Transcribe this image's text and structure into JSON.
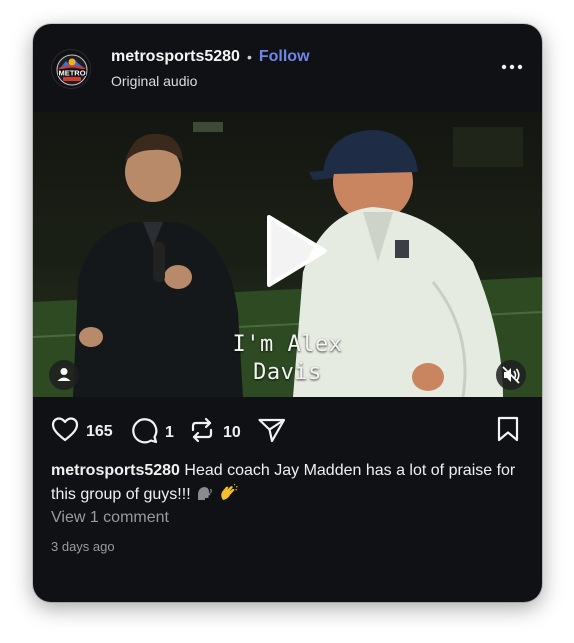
{
  "post": {
    "username": "metrosports5280",
    "separator": "•",
    "follow_label": "Follow",
    "audio_label": "Original audio",
    "avatar_logo_text": "METRO",
    "video": {
      "caption_line1": "I'm Alex",
      "caption_line2": "Davis"
    },
    "actions": {
      "likes": "165",
      "comments": "1",
      "reposts": "10"
    },
    "description": {
      "username": "metrosports5280",
      "text": " Head coach Jay Madden has a lot of praise for this group of guys!!! "
    },
    "view_comments_label": "View 1 comment",
    "timestamp": "3 days ago"
  },
  "icons": {
    "more": "more-horizontal-icon",
    "play": "play-icon",
    "user_tag": "person-icon",
    "mute": "speaker-muted-icon",
    "like": "heart-icon",
    "comment": "comment-bubble-icon",
    "repost": "repost-icon",
    "share": "send-icon",
    "save": "bookmark-icon"
  },
  "colors": {
    "background": "#0f1115",
    "follow": "#6f86e6",
    "muted_text": "#9a9aa0"
  }
}
